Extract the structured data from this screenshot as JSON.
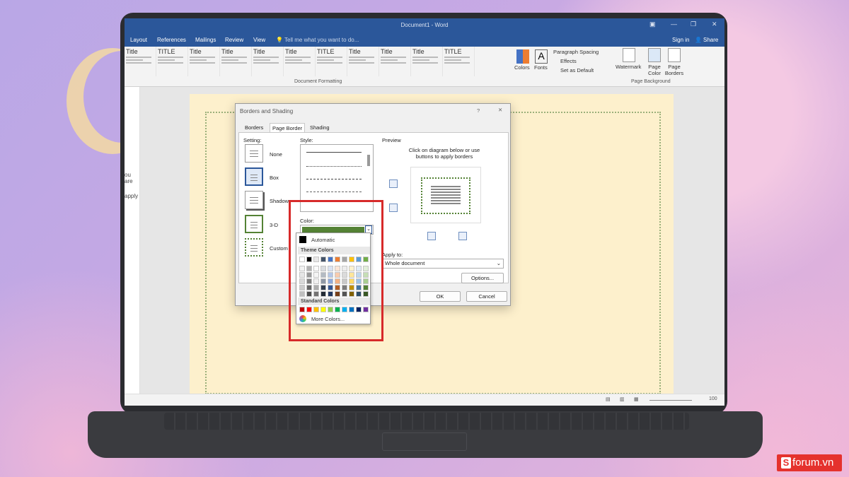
{
  "window": {
    "title": "Document1 - Word"
  },
  "menu": [
    "Layout",
    "References",
    "Mailings",
    "Review",
    "View"
  ],
  "tell_me": "Tell me what you want to do...",
  "signin": "Sign in",
  "share": "Share",
  "gallery": [
    "Title",
    "TITLE",
    "Title",
    "Title",
    "Title",
    "Title",
    "TITLE",
    "Title",
    "Title",
    "Title",
    "TITLE"
  ],
  "ribbon": {
    "colors": "Colors",
    "fonts": "Fonts",
    "paragraph_spacing": "Paragraph Spacing",
    "effects": "Effects",
    "set_default": "Set as Default",
    "watermark": "Watermark",
    "page_color": "Page Color",
    "page_borders": "Page Borders",
    "group_doc": "Document Formatting",
    "group_bg": "Page Background"
  },
  "nav_text": [
    "ou are",
    "apply"
  ],
  "dialog": {
    "title": "Borders and Shading",
    "help": "?",
    "close": "✕",
    "tabs": [
      "Borders",
      "Page Border",
      "Shading"
    ],
    "setting_label": "Setting:",
    "settings": [
      "None",
      "Box",
      "Shadow",
      "3-D",
      "Custom"
    ],
    "style_label": "Style:",
    "color_label": "Color:",
    "preview_label": "Preview",
    "preview_hint": "Click on diagram below or use buttons to apply borders",
    "apply_to_label": "Apply to:",
    "apply_to_value": "Whole document",
    "options": "Options...",
    "ok": "OK",
    "cancel": "Cancel",
    "selected_color": "#548235"
  },
  "picker": {
    "automatic": "Automatic",
    "theme_colors": "Theme Colors",
    "standard_colors": "Standard Colors",
    "more_colors": "More Colors...",
    "theme_top": [
      "#ffffff",
      "#000000",
      "#e7e6e6",
      "#44546a",
      "#4472c4",
      "#ed7d31",
      "#a5a5a5",
      "#ffc000",
      "#5b9bd5",
      "#70ad47"
    ],
    "standard": [
      "#c00000",
      "#ff0000",
      "#ffc000",
      "#ffff00",
      "#92d050",
      "#00b050",
      "#00b0f0",
      "#0070c0",
      "#002060",
      "#7030a0"
    ]
  },
  "status": {
    "zoom": "100"
  },
  "brand": {
    "name": "forum.vn",
    "letter": "S"
  }
}
